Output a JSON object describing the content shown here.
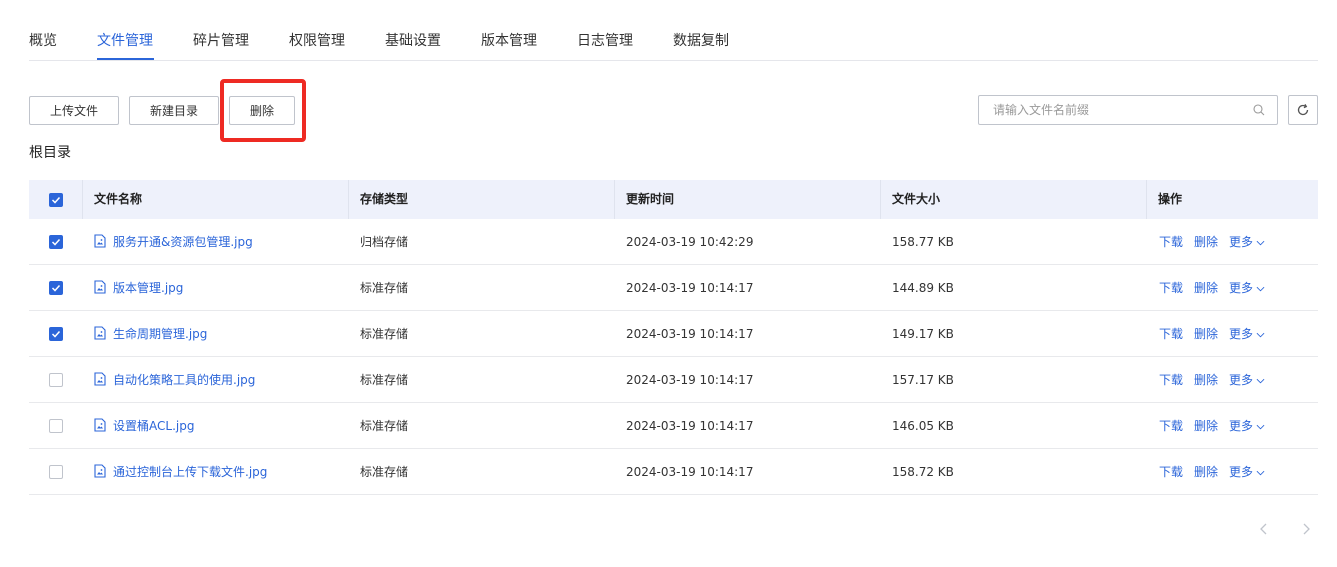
{
  "tabs": [
    {
      "label": "概览",
      "active": false
    },
    {
      "label": "文件管理",
      "active": true
    },
    {
      "label": "碎片管理",
      "active": false
    },
    {
      "label": "权限管理",
      "active": false
    },
    {
      "label": "基础设置",
      "active": false
    },
    {
      "label": "版本管理",
      "active": false
    },
    {
      "label": "日志管理",
      "active": false
    },
    {
      "label": "数据复制",
      "active": false
    }
  ],
  "toolbar": {
    "upload_label": "上传文件",
    "new_dir_label": "新建目录",
    "delete_label": "删除"
  },
  "search": {
    "placeholder": "请输入文件名前缀",
    "value": ""
  },
  "breadcrumb": "根目录",
  "table": {
    "headers": {
      "name": "文件名称",
      "storage": "存储类型",
      "updated": "更新时间",
      "size": "文件大小",
      "actions": "操作"
    },
    "header_checked": true,
    "rows": [
      {
        "checked": true,
        "name": "服务开通&资源包管理.jpg",
        "storage": "归档存储",
        "updated": "2024-03-19 10:42:29",
        "size": "158.77 KB"
      },
      {
        "checked": true,
        "name": "版本管理.jpg",
        "storage": "标准存储",
        "updated": "2024-03-19 10:14:17",
        "size": "144.89 KB"
      },
      {
        "checked": true,
        "name": "生命周期管理.jpg",
        "storage": "标准存储",
        "updated": "2024-03-19 10:14:17",
        "size": "149.17 KB"
      },
      {
        "checked": false,
        "name": "自动化策略工具的使用.jpg",
        "storage": "标准存储",
        "updated": "2024-03-19 10:14:17",
        "size": "157.17 KB"
      },
      {
        "checked": false,
        "name": "设置桶ACL.jpg",
        "storage": "标准存储",
        "updated": "2024-03-19 10:14:17",
        "size": "146.05 KB"
      },
      {
        "checked": false,
        "name": "通过控制台上传下载文件.jpg",
        "storage": "标准存储",
        "updated": "2024-03-19 10:14:17",
        "size": "158.72 KB"
      }
    ],
    "actions": {
      "download": "下载",
      "delete": "删除",
      "more": "更多"
    }
  },
  "colors": {
    "accent": "#2b65d9",
    "highlight": "#ee2a23",
    "header_bg": "#eef1fb"
  },
  "icons": [
    "search-icon",
    "refresh-icon",
    "file-image-icon",
    "chevron-down-icon",
    "chevron-left-icon",
    "chevron-right-icon",
    "check-icon"
  ]
}
